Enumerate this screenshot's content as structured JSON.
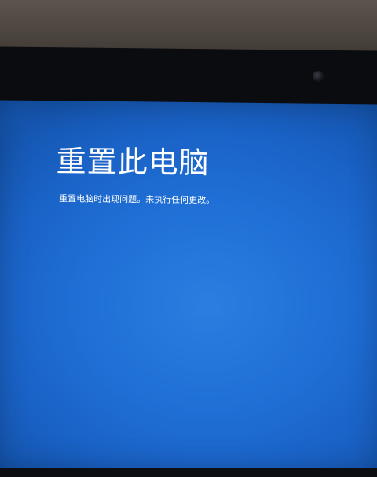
{
  "screen": {
    "title": "重置此电脑",
    "message": "重置电脑时出现问题。未执行任何更改。",
    "background_color": "#1f6fd6",
    "text_color": "#ffffff"
  }
}
